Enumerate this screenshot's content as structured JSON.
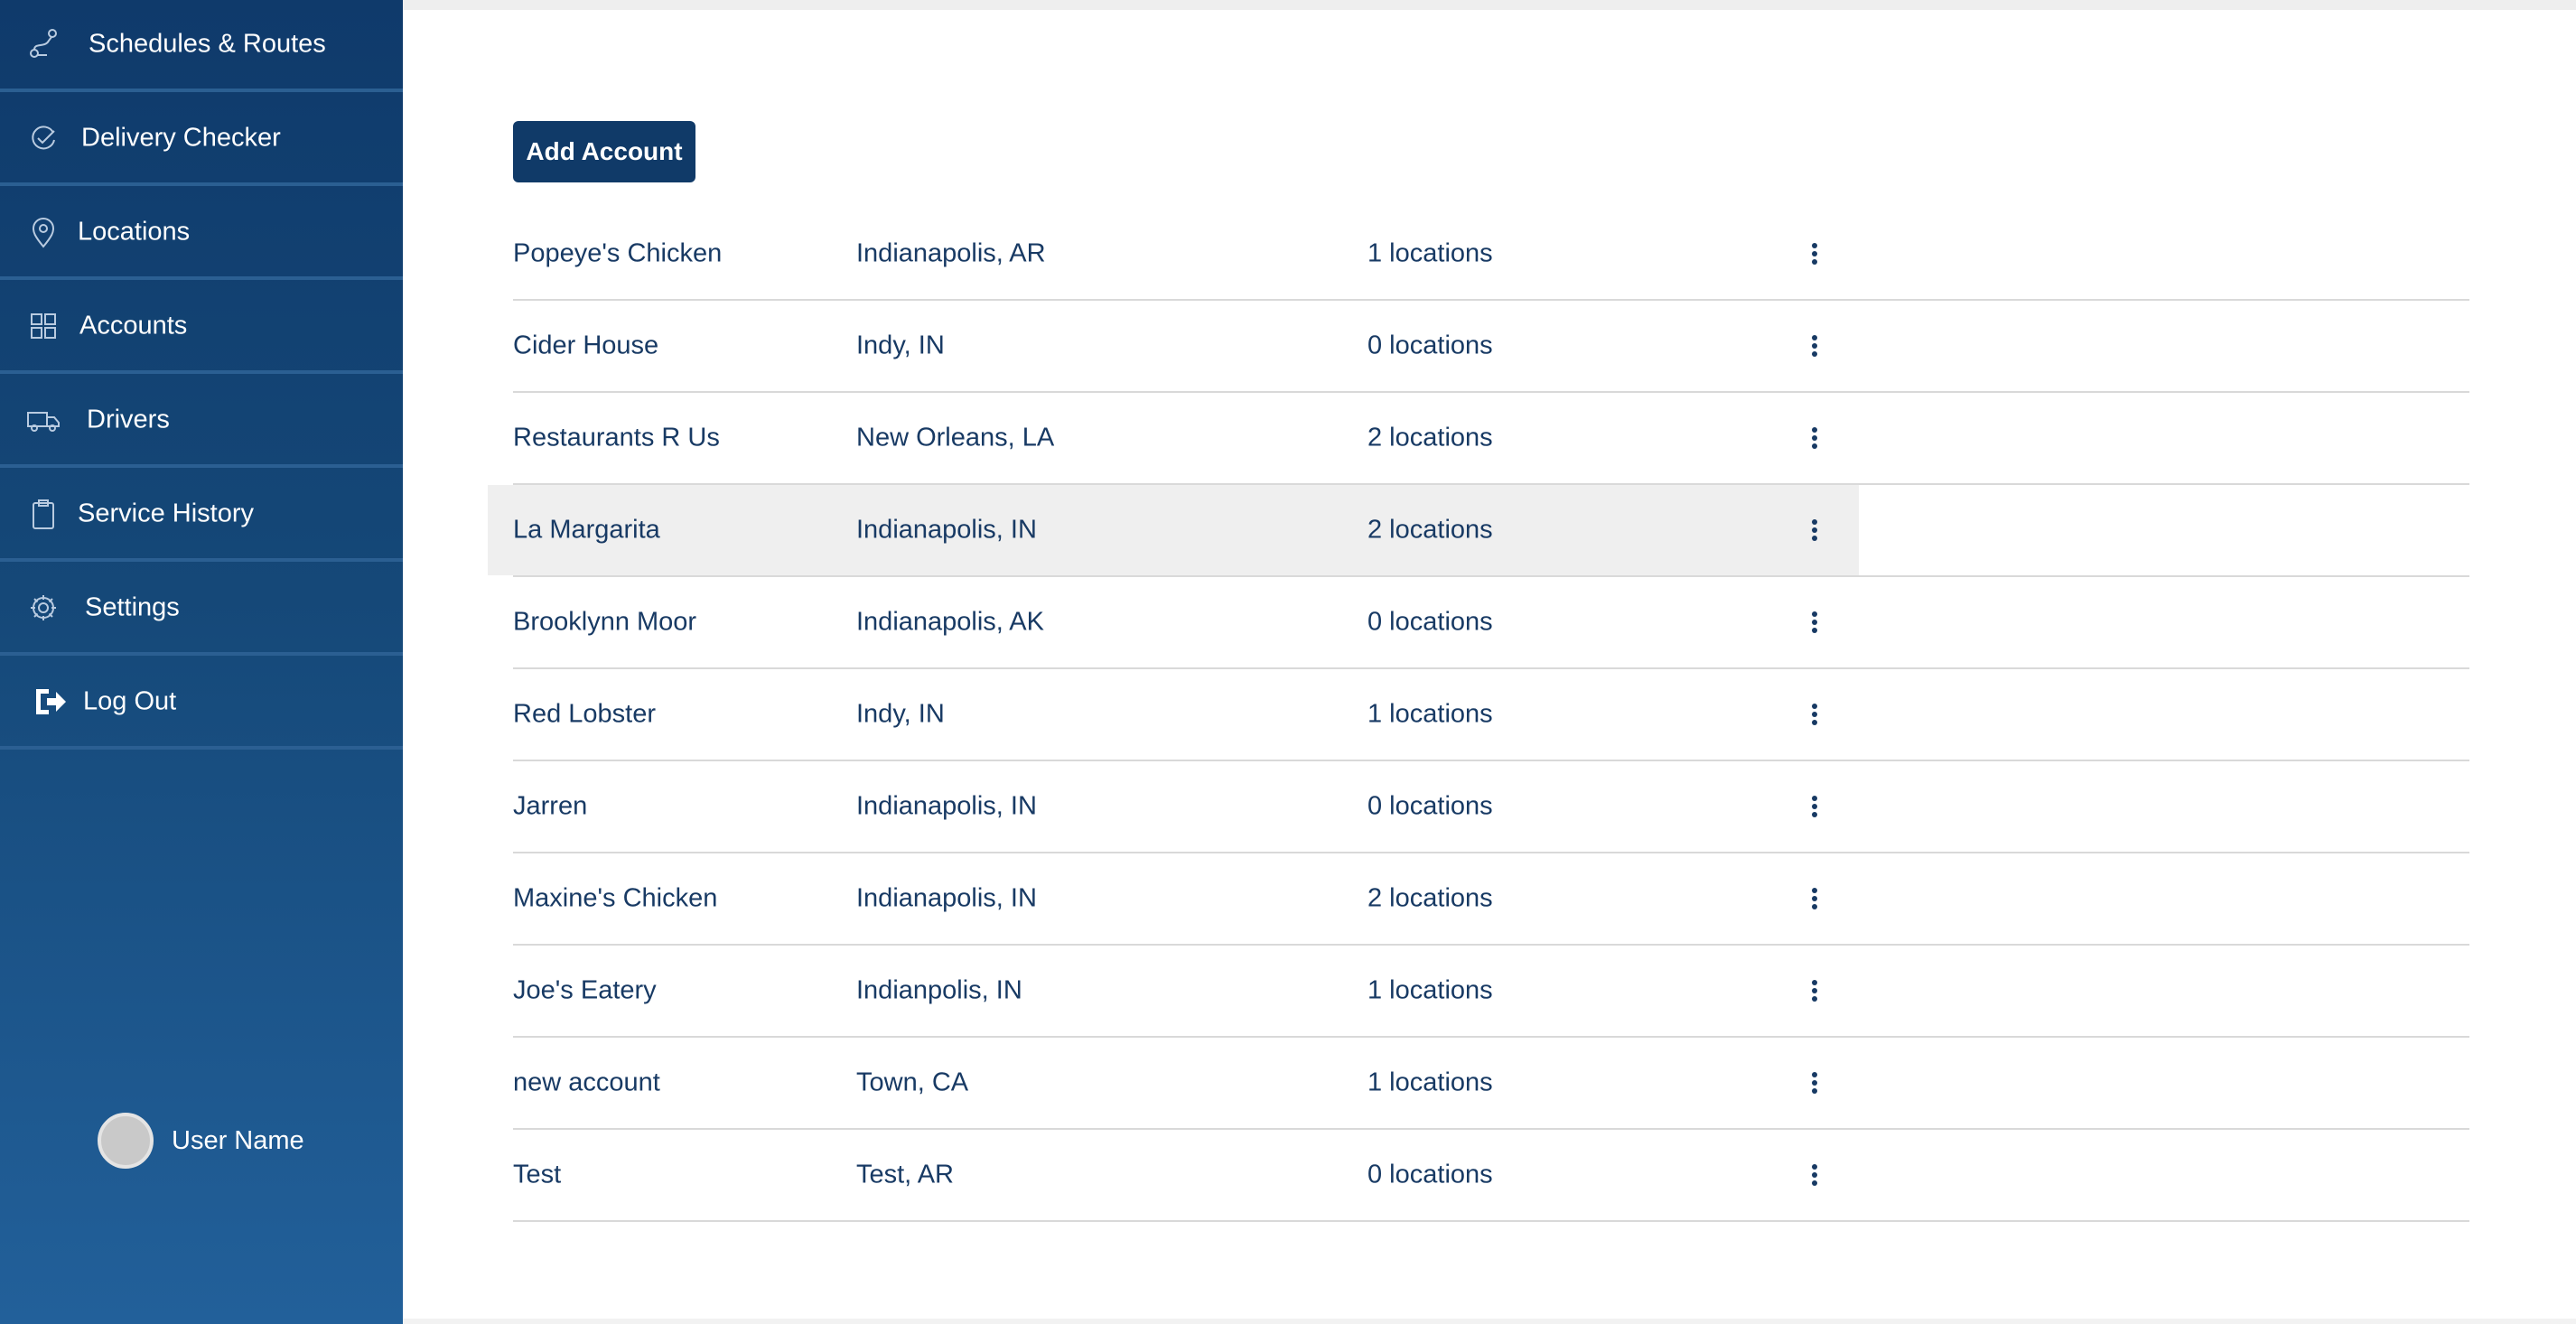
{
  "sidebar": {
    "items": [
      {
        "label": "Schedules & Routes",
        "icon": "route-icon"
      },
      {
        "label": "Delivery Checker",
        "icon": "check-circle-icon"
      },
      {
        "label": "Locations",
        "icon": "map-pin-icon"
      },
      {
        "label": "Accounts",
        "icon": "grid-icon"
      },
      {
        "label": "Drivers",
        "icon": "truck-icon"
      },
      {
        "label": "Service History",
        "icon": "clipboard-icon"
      },
      {
        "label": "Settings",
        "icon": "gear-icon"
      },
      {
        "label": "Log Out",
        "icon": "logout-icon"
      }
    ],
    "user_name": "User Name"
  },
  "main": {
    "add_button_label": "Add Account",
    "accounts": [
      {
        "name": "Popeye's Chicken",
        "city": "Indianapolis, AR",
        "locations": "1 locations"
      },
      {
        "name": "Cider House",
        "city": "Indy, IN",
        "locations": "0 locations"
      },
      {
        "name": "Restaurants R Us",
        "city": "New Orleans, LA",
        "locations": "2 locations"
      },
      {
        "name": "La Margarita",
        "city": "Indianapolis, IN",
        "locations": "2 locations",
        "highlighted": true
      },
      {
        "name": "Brooklynn Moor",
        "city": "Indianapolis, AK",
        "locations": "0 locations"
      },
      {
        "name": "Red Lobster",
        "city": "Indy, IN",
        "locations": "1 locations"
      },
      {
        "name": "Jarren",
        "city": "Indianapolis, IN",
        "locations": "0 locations"
      },
      {
        "name": "Maxine's Chicken",
        "city": "Indianapolis, IN",
        "locations": "2 locations"
      },
      {
        "name": "Joe's Eatery",
        "city": "Indianpolis, IN",
        "locations": "1 locations"
      },
      {
        "name": "new account",
        "city": "Town, CA",
        "locations": "1 locations"
      },
      {
        "name": "Test",
        "city": "Test, AR",
        "locations": "0 locations"
      }
    ]
  },
  "colors": {
    "sidebar_top": "#0f3a6b",
    "sidebar_bottom": "#22609a",
    "primary_button": "#103a68",
    "text": "#183a64",
    "row_highlight": "#efefef",
    "divider": "#d9d9d9"
  }
}
